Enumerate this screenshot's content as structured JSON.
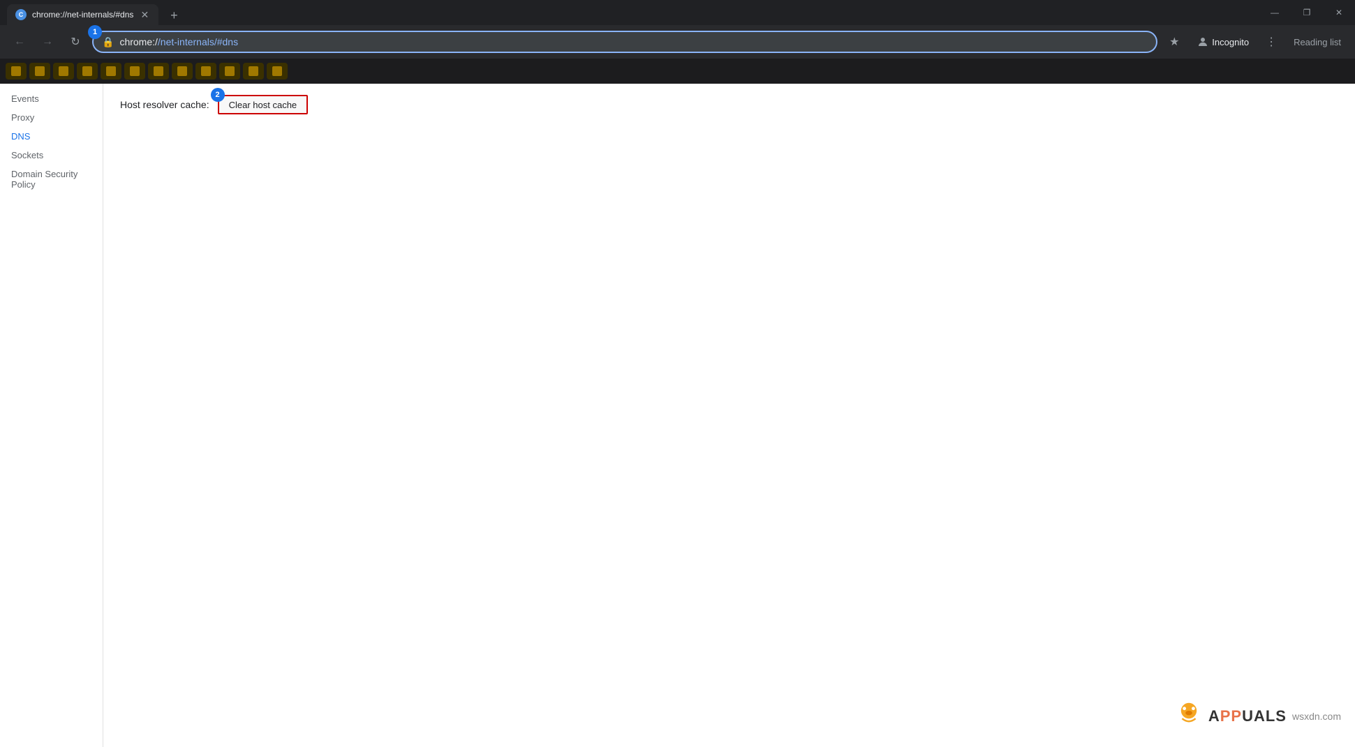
{
  "browser": {
    "tab": {
      "title": "chrome://net-internals/#dns",
      "favicon": "C"
    },
    "address_bar": {
      "url_prefix": "chrome:/",
      "url_main": "/net-internals/#dns",
      "full_url": "chrome://net-internals/#dns"
    },
    "incognito_label": "Incognito",
    "reading_list_label": "Reading list",
    "step1_badge": "1",
    "step2_badge": "2"
  },
  "sidebar": {
    "items": [
      {
        "label": "Events",
        "id": "events",
        "active": false
      },
      {
        "label": "Proxy",
        "id": "proxy",
        "active": false
      },
      {
        "label": "DNS",
        "id": "dns",
        "active": true
      },
      {
        "label": "Sockets",
        "id": "sockets",
        "active": false
      },
      {
        "label": "Domain Security Policy",
        "id": "domain-security-policy",
        "active": false
      }
    ]
  },
  "main": {
    "host_resolver_label": "Host resolver cache:",
    "clear_cache_button_label": "Clear host cache"
  },
  "watermark": {
    "site": "wsxdn.com"
  },
  "window_controls": {
    "minimize": "—",
    "restore": "❐",
    "close": "✕"
  }
}
